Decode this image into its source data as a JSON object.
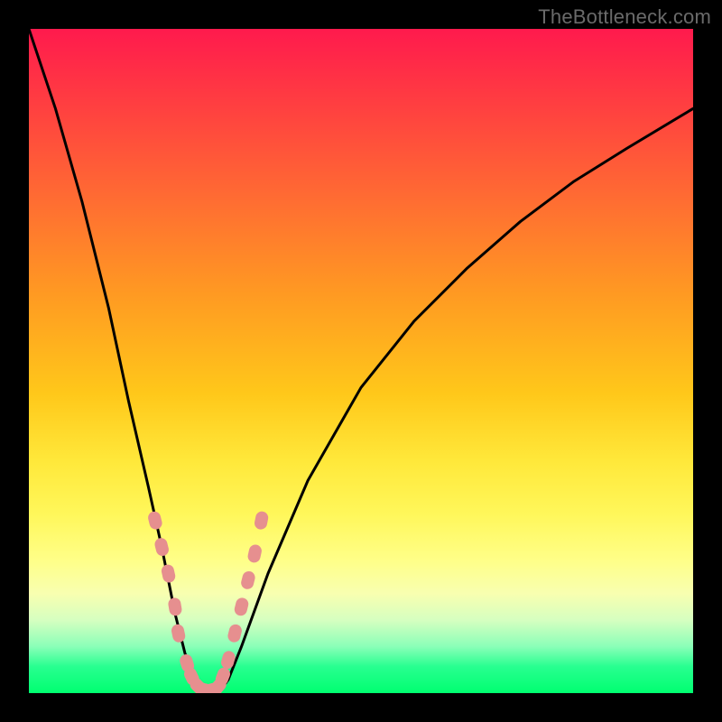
{
  "watermark": "TheBottleneck.com",
  "colors": {
    "frame": "#000000",
    "curve": "#000000",
    "marker": "#e68f8f",
    "gradient_top": "#ff1a4d",
    "gradient_bottom": "#00ff70"
  },
  "chart_data": {
    "type": "line",
    "title": "",
    "xlabel": "",
    "ylabel": "",
    "xlim": [
      0,
      100
    ],
    "ylim": [
      0,
      100
    ],
    "grid": false,
    "legend": false,
    "series": [
      {
        "name": "bottleneck-curve",
        "x": [
          0,
          4,
          8,
          12,
          15,
          18,
          20,
          22,
          23.5,
          25,
          27,
          28.5,
          30,
          32,
          36,
          42,
          50,
          58,
          66,
          74,
          82,
          90,
          100
        ],
        "y": [
          100,
          88,
          74,
          58,
          44,
          31,
          22,
          12,
          6,
          2,
          0,
          0,
          2,
          7,
          18,
          32,
          46,
          56,
          64,
          71,
          77,
          82,
          88
        ]
      }
    ],
    "markers": {
      "name": "highlight-points",
      "x": [
        19,
        20,
        21,
        22,
        22.5,
        23.8,
        24.5,
        25.5,
        26.5,
        27.5,
        28.5,
        29.2,
        30,
        31,
        32,
        33,
        34,
        35
      ],
      "y": [
        26,
        22,
        18,
        13,
        9,
        4.5,
        2.5,
        1.0,
        0.5,
        0.5,
        1.0,
        2.5,
        5,
        9,
        13,
        17,
        21,
        26
      ]
    }
  }
}
